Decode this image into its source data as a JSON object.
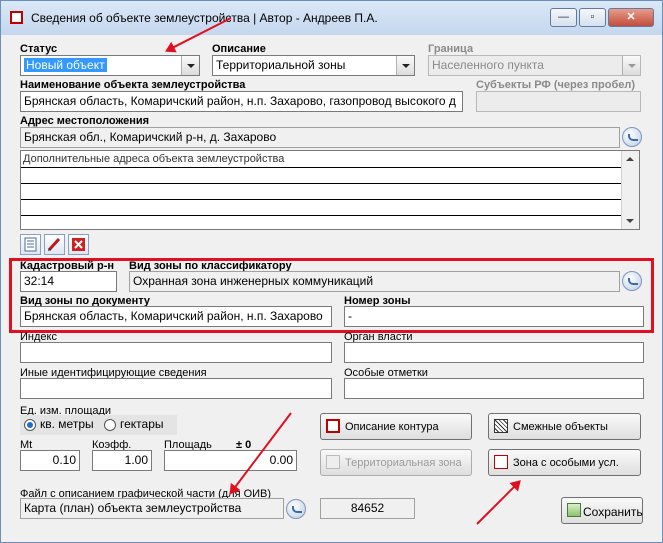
{
  "window": {
    "title": "Сведения об объекте землеустройства | Автор - Андреев П.А.",
    "minimize_glyph": "—",
    "maximize_glyph": "▫",
    "close_glyph": "✕"
  },
  "fields": {
    "status": {
      "label": "Статус",
      "value": "Новый объект"
    },
    "description": {
      "label": "Описание",
      "value": "Территориальной зоны"
    },
    "boundary": {
      "label": "Граница",
      "value": "Населенного пункта"
    },
    "object_name": {
      "label": "Наименование объекта землеустройства",
      "value": "Брянская область, Комаричский район, н.п. Захарово, газопровод высокого д"
    },
    "subjects": {
      "label": "Субъекты РФ (через пробел)",
      "value": ""
    },
    "address": {
      "label": "Адрес местоположения",
      "value": "Брянская обл., Комаричский р-н, д. Захарово"
    },
    "additional_addresses": {
      "label": "Дополнительные адреса объекта землеустройства"
    },
    "cadastral": {
      "label": "Кадастровый р-н",
      "value": "32:14"
    },
    "zone_type_classifier": {
      "label": "Вид зоны по классификатору",
      "value": "Охранная зона инженерных коммуникаций"
    },
    "zone_type_document": {
      "label": "Вид зоны по документу",
      "value": "Брянская область, Комаричский район, н.п. Захарово"
    },
    "zone_number": {
      "label": "Номер зоны",
      "value": "-"
    },
    "index": {
      "label": "Индекс",
      "value": ""
    },
    "authority": {
      "label": "Орган власти",
      "value": ""
    },
    "other_ids": {
      "label": "Иные идентифицирующие сведения",
      "value": ""
    },
    "special_notes": {
      "label": "Особые отметки",
      "value": ""
    },
    "area_unit": {
      "label": "Ед. изм. площади",
      "options": [
        "кв. метры",
        "гектары"
      ],
      "selected": "кв. метры"
    },
    "mt": {
      "label": "Mt",
      "value": "0.10"
    },
    "coeff": {
      "label": "Коэфф.",
      "value": "1.00"
    },
    "area": {
      "label": "Площадь",
      "tolerance_label": "± 0",
      "value": "0.00"
    },
    "graphic_file": {
      "label": "Файл с описанием графической части (для ОИВ)",
      "value": "Карта (план) объекта землеустройства",
      "number": "84652"
    }
  },
  "buttons": {
    "contour": "Описание контура",
    "adjacent": "Смежные объекты",
    "territorial": "Территориальная зона",
    "special": "Зона с особыми усл.",
    "save": "Сохранить"
  },
  "colors": {
    "accent_red": "#e01020",
    "selection_blue": "#3399ff",
    "window_bg": "#f0f0f0"
  },
  "icons": {
    "app": "app-icon",
    "list_tools": [
      "document-list-icon",
      "edit-pencil-icon",
      "delete-icon"
    ],
    "field_action": "refresh-icon",
    "contour": "contour-icon",
    "adjacent": "adjacent-objects-icon",
    "territorial": "territorial-zone-icon",
    "special": "special-zone-icon",
    "save": "save-icon"
  }
}
